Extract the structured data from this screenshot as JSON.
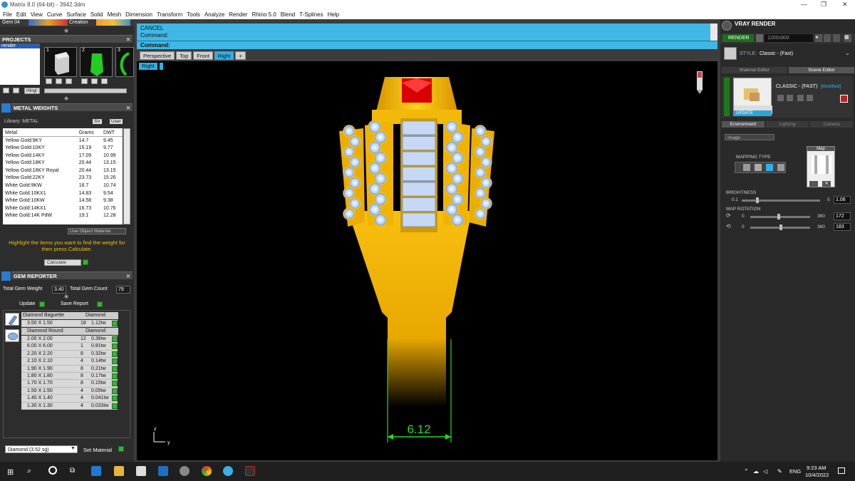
{
  "window": {
    "title": "Matrix 8.0 (64-bit) - 3942.3dm",
    "min_glyph": "—",
    "max_glyph": "❐",
    "close_glyph": "✕"
  },
  "menu": [
    "File",
    "Edit",
    "View",
    "Curve",
    "Surface",
    "Solid",
    "Mesh",
    "Dimension",
    "Transform",
    "Tools",
    "Analyze",
    "Render",
    "Rhino 5.0",
    "Blend",
    "T-Splines",
    "Help"
  ],
  "left": {
    "gem_label": "Gem 04",
    "creation_label": "Creation",
    "projects_title": "PROJECTS",
    "project_item": "render",
    "thumbs": [
      "1",
      "2",
      "3"
    ],
    "hinge_label": "Hingr",
    "metal_title": "METAL WEIGHTS",
    "library_label": "Library: METAL",
    "sv_label": "SV",
    "user_label": "User",
    "metal_headers": [
      "Metal",
      "Grams",
      "DWT"
    ],
    "metals": [
      [
        "Yellow Gold:9KY",
        "14.7",
        "9.45"
      ],
      [
        "Yellow Gold:10KY",
        "15.19",
        "9.77"
      ],
      [
        "Yellow Gold:14KY",
        "17.09",
        "10.99"
      ],
      [
        "Yellow Gold:18KY",
        "20.44",
        "13.15"
      ],
      [
        "Yellow Gold:18KY Royal",
        "20.44",
        "13.15"
      ],
      [
        "Yellow Gold:22KY",
        "23.73",
        "15.26"
      ],
      [
        "White Gold:9KW",
        "16.7",
        "10.74"
      ],
      [
        "White Gold:10KX1",
        "14.83",
        "9.54"
      ],
      [
        "White Gold:10KW",
        "14.58",
        "9.38"
      ],
      [
        "White Gold:14KX1",
        "16.73",
        "10.76"
      ],
      [
        "White Gold:14K PdW",
        "19.1",
        "12.28"
      ]
    ],
    "use_object_material": "Use Object Material",
    "hint": "Highlight the items you want to find the weight for then press Calculate.",
    "calculate_label": "Calculate",
    "gem_reporter_title": "GEM REPORTER",
    "total_weight_label": "Total Gem Weight",
    "total_weight": "3.40",
    "total_count_label": "Total Gem Count",
    "total_count": "79",
    "update_label": "Update",
    "save_report_label": "Save Report",
    "baguette": {
      "name": "Diamond Baguette",
      "stone": "Diamond",
      "rows": [
        [
          "3.50 X 1.50",
          "18",
          "1.12tw"
        ]
      ]
    },
    "round": {
      "name": "Diamond Round",
      "stone": "Diamond",
      "rows": [
        [
          "2.00 X 2.00",
          "12",
          "0.36tw"
        ],
        [
          "6.00 X 6.00",
          "1",
          "0.81tw"
        ],
        [
          "2.20 X 2.20",
          "8",
          "0.32tw"
        ],
        [
          "2.10 X 2.10",
          "4",
          "0.14tw"
        ],
        [
          "1.90 X 1.90",
          "8",
          "0.21tw"
        ],
        [
          "1.80 X 1.80",
          "8",
          "0.17tw"
        ],
        [
          "1.70 X 1.70",
          "8",
          "0.15tw"
        ],
        [
          "1.50 X 1.50",
          "4",
          "0.05tw"
        ],
        [
          "1.40 X 1.40",
          "4",
          "0.041tw"
        ],
        [
          "1.30 X 1.30",
          "4",
          "0.033tw"
        ]
      ]
    },
    "material_select": "Diamond   (3.52 sg)",
    "set_material_label": "Set Material"
  },
  "command": {
    "line1": "CANCEL",
    "line2": "Command:",
    "prompt": "Command:"
  },
  "views": [
    "Perspective",
    "Top",
    "Front",
    "Right",
    "+"
  ],
  "active_view": "Right",
  "viewport_label": "Right",
  "dimension": "6.12",
  "axis": {
    "z": "z",
    "y": "y"
  },
  "right": {
    "title": "VRAY RENDER",
    "render_label": "RENDER",
    "resolution": "1200x900",
    "style_label": "STYLE:",
    "style_value": "Classic - (Fast)",
    "tab_material": "Material Editor",
    "tab_scene": "Scene Editor",
    "classic_label": "CLASSIC - (FAST)",
    "modified": "[Modified]",
    "update_label": "UPDATE",
    "env_tabs": [
      "Environment",
      "Lighting",
      "Camera"
    ],
    "env_select": "Image",
    "mapping_type": "MAPPING TYPE",
    "map_label": "Map",
    "brightness_label": "BRIGHTNESS",
    "brightness_min": "0.1",
    "brightness_max": "5",
    "brightness_value": "1.06",
    "map_rotation_label": "MAP ROTATION",
    "rot1_min": "0",
    "rot1_max": "360",
    "rot1_value": "172",
    "rot2_min": "0",
    "rot2_max": "360",
    "rot2_value": "183"
  },
  "taskbar": {
    "lang": "ENG",
    "time": "9:23 AM",
    "date": "10/4/2022"
  },
  "colors": {
    "accent": "#3fb8e6",
    "gold": "#f2b10a",
    "ruby": "#d80000",
    "green": "#22dd22"
  }
}
